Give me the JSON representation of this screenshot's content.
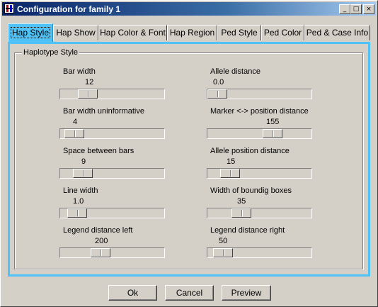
{
  "window": {
    "title": "Configuration for family 1"
  },
  "titlebar_buttons": {
    "minimize": "_",
    "maximize": "□",
    "close": "×"
  },
  "tabs": [
    {
      "label": "Hap Style",
      "active": true
    },
    {
      "label": "Hap Show"
    },
    {
      "label": "Hap Color & Font"
    },
    {
      "label": "Hap Region"
    },
    {
      "label": "Ped Style"
    },
    {
      "label": "Ped Color"
    },
    {
      "label": "Ped & Case Info"
    }
  ],
  "group": {
    "title": "Haplotype Style"
  },
  "settings": {
    "bar_width": {
      "label": "Bar width",
      "value": "12"
    },
    "bar_width_uninformative": {
      "label": "Bar width uninformative",
      "value": "4"
    },
    "space_between_bars": {
      "label": "Space between bars",
      "value": "9"
    },
    "line_width": {
      "label": "Line width",
      "value": "1.0"
    },
    "legend_distance_left": {
      "label": "Legend distance left",
      "value": "200"
    },
    "allele_distance": {
      "label": "Allele distance",
      "value": "0.0"
    },
    "marker_position_distance": {
      "label": "Marker <-> position distance",
      "value": "155"
    },
    "allele_position_distance": {
      "label": "Allele position distance",
      "value": "15"
    },
    "width_bounding_boxes": {
      "label": "Width of boundig boxes",
      "value": "35"
    },
    "legend_distance_right": {
      "label": "Legend distance right",
      "value": "50"
    }
  },
  "buttons": {
    "ok": "Ok",
    "cancel": "Cancel",
    "preview": "Preview"
  }
}
